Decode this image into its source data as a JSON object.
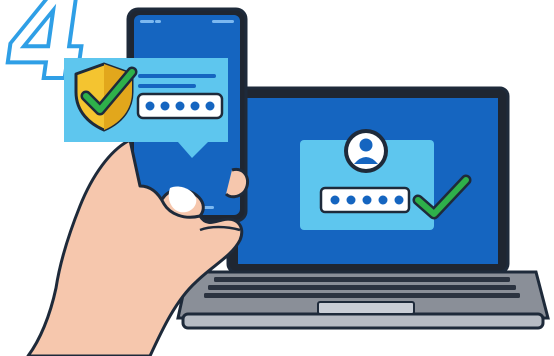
{
  "illustration": {
    "step_number": "4",
    "icons": {
      "shield": "shield-check-icon",
      "user": "user-avatar-icon",
      "phone_check": "check-icon",
      "laptop_check": "check-icon"
    },
    "password_mask": "●●●●●"
  },
  "colors": {
    "screen_blue": "#1565c0",
    "panel_light_blue": "#5ec6ee",
    "outline_dark": "#1e2a3a",
    "check_green": "#2eb04a",
    "shield_gold": "#f4c430",
    "skin": "#f6c7ad",
    "laptop_grey": "#8a8f98",
    "number_outline": "#2f9fe6"
  }
}
